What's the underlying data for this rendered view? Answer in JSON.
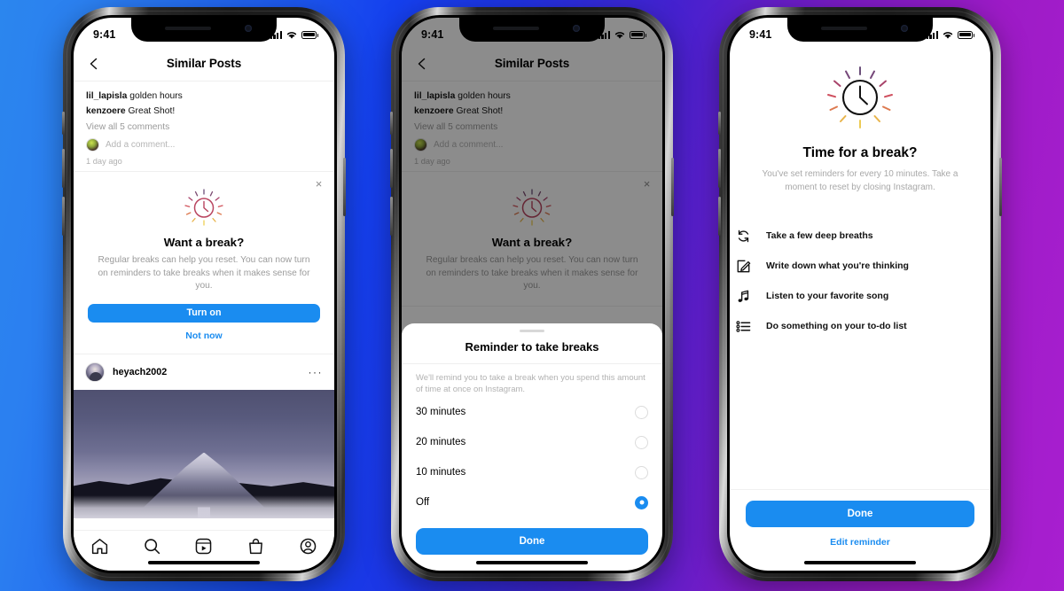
{
  "background": {
    "left_color": "#2b86ee",
    "mid_color": "#1540ee",
    "right_color": "#a81fd0"
  },
  "accent": {
    "blue": "#1a8cf0",
    "muted_gray": "#9b9b9b"
  },
  "status_bar": {
    "time": "9:41",
    "signal": "signal-bars-icon",
    "wifi": "wifi-icon",
    "battery": "battery-full-icon"
  },
  "phone1": {
    "header": {
      "back": "‹",
      "title": "Similar Posts"
    },
    "comments": {
      "c1_user": "lil_lapisla",
      "c1_text": "golden hours",
      "c2_user": "kenzoere",
      "c2_text": "Great Shot!",
      "view_all": "View all 5 comments",
      "add_comment_placeholder": "Add a comment...",
      "timestamp": "1 day ago"
    },
    "break_card": {
      "close": "×",
      "title": "Want a break?",
      "body": "Regular breaks can help you reset. You can now turn on reminders to take breaks when it makes sense for you.",
      "primary": "Turn on",
      "secondary": "Not now"
    },
    "post": {
      "username": "heyach2002",
      "more": "···"
    },
    "tabbar": [
      "home-icon",
      "search-icon",
      "reels-icon",
      "shop-icon",
      "profile-icon"
    ]
  },
  "phone2": {
    "header": {
      "back": "‹",
      "title": "Similar Posts"
    },
    "comments": {
      "c1_user": "lil_lapisla",
      "c1_text": "golden hours",
      "c2_user": "kenzoere",
      "c2_text": "Great Shot!",
      "view_all": "View all 5 comments",
      "add_comment_placeholder": "Add a comment...",
      "timestamp": "1 day ago"
    },
    "break_card": {
      "close": "×",
      "title": "Want a break?",
      "body": "Regular breaks can help you reset. You can now turn on reminders to take breaks when it makes sense for you."
    },
    "sheet": {
      "title": "Reminder to take breaks",
      "description": "We'll remind you to take a break when you spend this amount of time at once on Instagram.",
      "options": [
        {
          "label": "30 minutes",
          "selected": false
        },
        {
          "label": "20 minutes",
          "selected": false
        },
        {
          "label": "10 minutes",
          "selected": false
        },
        {
          "label": "Off",
          "selected": true
        }
      ],
      "cta": "Done"
    }
  },
  "phone3": {
    "illustration": "clock-burst-icon",
    "title": "Time for a break?",
    "subtitle": "You've set reminders for every 10 minutes. Take a moment to reset by closing Instagram.",
    "suggestions": [
      {
        "icon": "refresh-breath-icon",
        "label": "Take a few deep breaths"
      },
      {
        "icon": "pencil-note-icon",
        "label": "Write down what you're thinking"
      },
      {
        "icon": "music-note-icon",
        "label": "Listen to your favorite song"
      },
      {
        "icon": "todo-list-icon",
        "label": "Do something on your to-do list"
      }
    ],
    "done": "Done",
    "edit": "Edit reminder"
  }
}
